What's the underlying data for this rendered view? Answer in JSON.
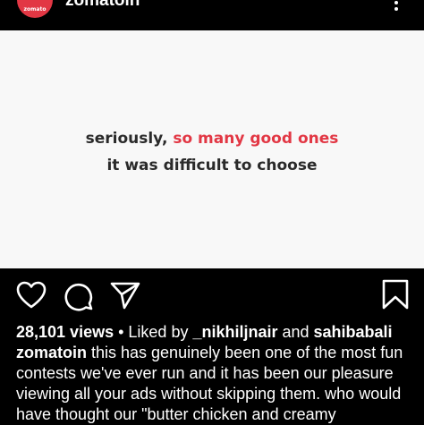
{
  "header": {
    "avatar_text": "zomato",
    "username": "zomatoin"
  },
  "post": {
    "line1_prefix": "seriously, ",
    "line1_accent": "so many good ones",
    "line2": "it was difficult to choose"
  },
  "stats": {
    "views": "28,101 views",
    "separator": " • ",
    "liked_by_prefix": "Liked by ",
    "liker1": "_nikhiljnair",
    "and": " and ",
    "liker2": "sahibabali"
  },
  "caption": {
    "username": "zomatoin",
    "text": " this has genuinely been one of the most fun contests we've ever run and it has been our pleasure viewing all your ads without skipping them. who would have thought our \"butter chicken and creamy"
  },
  "colors": {
    "accent": "#e23744",
    "background": "#000000",
    "image_bg": "#f8f8f8"
  },
  "icons": [
    "more-icon",
    "heart-icon",
    "comment-icon",
    "share-icon",
    "bookmark-icon"
  ]
}
